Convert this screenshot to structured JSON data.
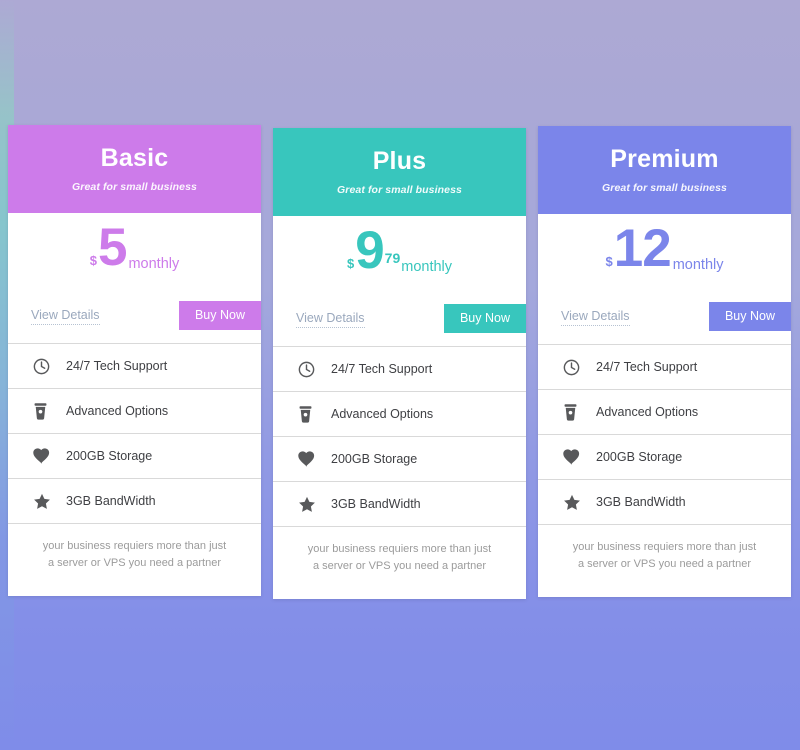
{
  "page": {
    "background_top": "#ada9d4",
    "background_bottom": "#7f8ce9"
  },
  "plans": [
    {
      "name": "Basic",
      "tagline": "Great for small business",
      "accent": "#cd7bea",
      "currency": "$",
      "amount": "5",
      "cents": "",
      "period": "monthly",
      "view_details": "View Details",
      "buy_now": "Buy Now",
      "features": [
        {
          "icon": "clock-icon",
          "label": "24/7 Tech Support"
        },
        {
          "icon": "cup-icon",
          "label": "Advanced Options"
        },
        {
          "icon": "heart-icon",
          "label": "200GB Storage"
        },
        {
          "icon": "star-icon",
          "label": "3GB BandWidth"
        }
      ],
      "footer_line1": "your business requiers more than just",
      "footer_line2": "a server or VPS you need a partner"
    },
    {
      "name": "Plus",
      "tagline": "Great for small business",
      "accent": "#38c6bd",
      "currency": "$",
      "amount": "9",
      "cents": "79",
      "period": "monthly",
      "view_details": "View Details",
      "buy_now": "Buy Now",
      "features": [
        {
          "icon": "clock-icon",
          "label": "24/7 Tech Support"
        },
        {
          "icon": "cup-icon",
          "label": "Advanced Options"
        },
        {
          "icon": "heart-icon",
          "label": "200GB Storage"
        },
        {
          "icon": "star-icon",
          "label": "3GB BandWidth"
        }
      ],
      "footer_line1": "your business requiers more than just",
      "footer_line2": "a server or VPS you need a partner"
    },
    {
      "name": "Premium",
      "tagline": "Great for small business",
      "accent": "#7b85ea",
      "currency": "$",
      "amount": "12",
      "cents": "",
      "period": "monthly",
      "view_details": "View Details",
      "buy_now": "Buy Now",
      "features": [
        {
          "icon": "clock-icon",
          "label": "24/7 Tech Support"
        },
        {
          "icon": "cup-icon",
          "label": "Advanced Options"
        },
        {
          "icon": "heart-icon",
          "label": "200GB Storage"
        },
        {
          "icon": "star-icon",
          "label": "3GB BandWidth"
        }
      ],
      "footer_line1": "your business requiers more than just",
      "footer_line2": "a server or VPS you need a partner"
    }
  ]
}
